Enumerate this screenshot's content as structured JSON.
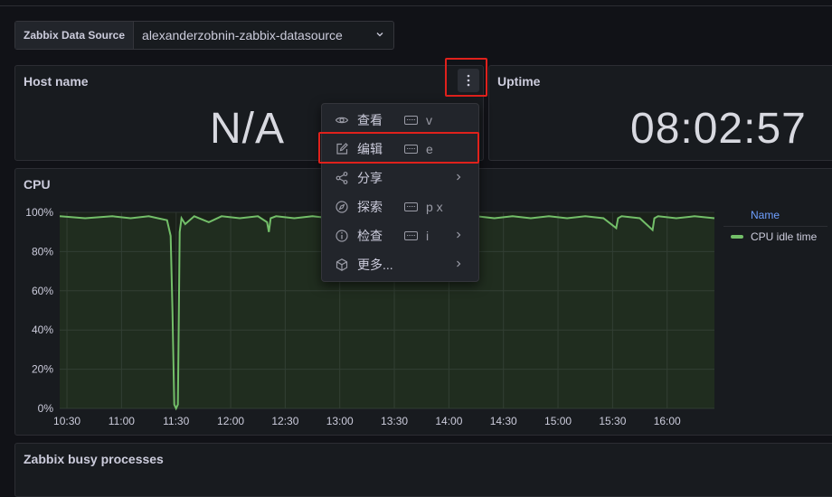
{
  "variable": {
    "label": "Zabbix Data Source",
    "value": "alexanderzobnin-zabbix-datasource"
  },
  "panels": {
    "host": {
      "title": "Host name",
      "value": "N/A"
    },
    "uptime": {
      "title": "Uptime",
      "value": "08:02:57"
    },
    "cpu": {
      "title": "CPU"
    },
    "busy": {
      "title": "Zabbix busy processes"
    }
  },
  "menu": {
    "items": [
      {
        "label": "查看",
        "key": "v",
        "icon": "eye-icon",
        "has_shortcut": true,
        "submenu": false
      },
      {
        "label": "编辑",
        "key": "e",
        "icon": "edit-icon",
        "has_shortcut": true,
        "submenu": false
      },
      {
        "label": "分享",
        "key": "",
        "icon": "share-icon",
        "has_shortcut": false,
        "submenu": true
      },
      {
        "label": "探索",
        "key": "p x",
        "icon": "compass-icon",
        "has_shortcut": true,
        "submenu": false
      },
      {
        "label": "检查",
        "key": "i",
        "icon": "info-icon",
        "has_shortcut": true,
        "submenu": true
      },
      {
        "label": "更多...",
        "key": "",
        "icon": "cube-icon",
        "has_shortcut": false,
        "submenu": true
      }
    ]
  },
  "legend": {
    "header": "Name"
  },
  "colors": {
    "series": "#73bf69",
    "highlight": "#e0211c",
    "legend_header": "#6e9fff"
  },
  "chart_data": {
    "type": "line",
    "x_ticks": [
      "10:30",
      "11:00",
      "11:30",
      "12:00",
      "12:30",
      "13:00",
      "13:30",
      "14:00",
      "14:30",
      "15:00",
      "15:30",
      "16:00"
    ],
    "y_ticks": [
      "0%",
      "20%",
      "40%",
      "60%",
      "80%",
      "100%"
    ],
    "ylim": [
      0,
      100
    ],
    "xlim": [
      "10:26",
      "16:26"
    ],
    "series": [
      {
        "name": "CPU idle time",
        "x": [
          "10:26",
          "10:40",
          "10:55",
          "11:05",
          "11:15",
          "11:20",
          "11:25",
          "11:27",
          "11:28",
          "11:29",
          "11:30",
          "11:31",
          "11:32",
          "11:33",
          "11:35",
          "11:40",
          "11:48",
          "11:55",
          "12:05",
          "12:15",
          "12:20",
          "12:21",
          "12:22",
          "12:25",
          "12:35",
          "12:45",
          "12:55",
          "13:05",
          "13:15",
          "13:25",
          "13:35",
          "13:45",
          "13:55",
          "14:05",
          "14:15",
          "14:25",
          "14:35",
          "14:45",
          "14:55",
          "15:05",
          "15:15",
          "15:25",
          "15:32",
          "15:33",
          "15:35",
          "15:45",
          "15:52",
          "15:53",
          "15:55",
          "16:05",
          "16:15",
          "16:26"
        ],
        "y": [
          98,
          97,
          98,
          97,
          98,
          97,
          96,
          88,
          50,
          2,
          0,
          2,
          90,
          97,
          94,
          98,
          95,
          98,
          97,
          98,
          95,
          90,
          97,
          98,
          97,
          98,
          97,
          98,
          97,
          97,
          98,
          97,
          98,
          97,
          98,
          97,
          98,
          97,
          98,
          97,
          98,
          97,
          92,
          97,
          98,
          97,
          91,
          97,
          98,
          97,
          98,
          97
        ]
      }
    ]
  }
}
